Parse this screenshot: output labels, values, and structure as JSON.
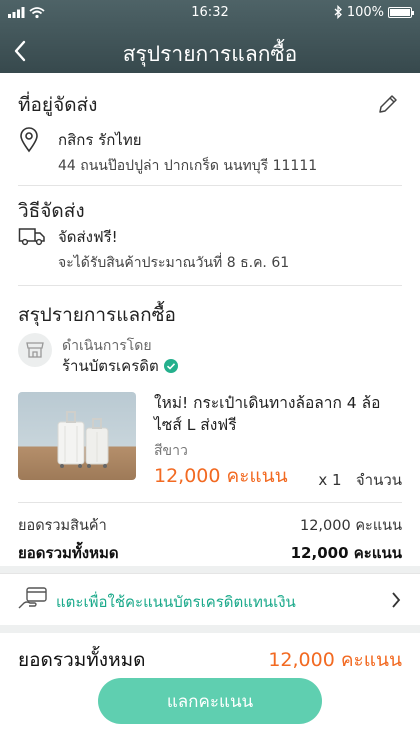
{
  "status_bar": {
    "time": "16:32",
    "battery": "100%"
  },
  "header": {
    "title": "สรุปรายการแลกซื้อ"
  },
  "address": {
    "title": "ที่อยู่จัดส่ง",
    "name": "กสิกร รักไทย",
    "detail": "44 ถนนป๊อปปูล่า ปากเกร็ด นนทบุรี 11111"
  },
  "shipping": {
    "title": "วิธีจัดส่ง",
    "method": "จัดส่งฟรี!",
    "estimate": "จะได้รับสินค้าประมาณวันที่ 8 ธ.ค. 61"
  },
  "summary": {
    "title": "สรุปรายการแลกซื้อ",
    "operated_by": "ดำเนินการโดย",
    "store_name": "ร้านบัตรเครดิต"
  },
  "product": {
    "name_line1": "ใหม่! กระเป๋าเดินทางล้อลาก 4 ล้อ",
    "name_line2": "ไซส์ L   ส่งฟรี",
    "color": "สีขาว",
    "price": "12,000 คะแนน",
    "quantity": "x 1   จำนวน"
  },
  "totals": {
    "subtotal_label": "ยอดรวมสินค้า",
    "subtotal_value": "12,000 คะแนน",
    "total_label": "ยอดรวมทั้งหมด",
    "total_value": "12,000 คะแนน"
  },
  "promo": {
    "text": "แตะเพื่อใช้คะแนนบัตรเครดิตแทนเงิน"
  },
  "footer": {
    "total_label": "ยอดรวมทั้งหมด",
    "total_value": "12,000 คะแนน",
    "redeem_button": "แลกคะแนน"
  },
  "colors": {
    "accent": "#1aa98a",
    "price": "#f26a22",
    "button": "#5fcfb0",
    "header": "#3f5256"
  }
}
